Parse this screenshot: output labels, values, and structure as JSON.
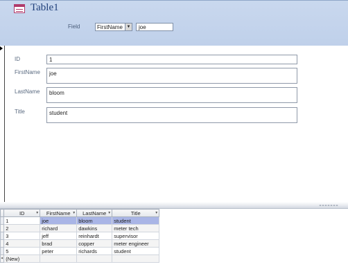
{
  "form": {
    "title": "Table1",
    "field_label": "Field",
    "field_select_value": "FirstName",
    "field_value": "joe"
  },
  "detail": {
    "fields": [
      {
        "label": "ID",
        "value": "1"
      },
      {
        "label": "FirstName",
        "value": "joe"
      },
      {
        "label": "LastName",
        "value": "bloom"
      },
      {
        "label": "Title",
        "value": "student"
      }
    ]
  },
  "datasheet": {
    "columns": [
      "ID",
      "FirstName",
      "LastName",
      "Title"
    ],
    "rows": [
      {
        "id": "1",
        "first": "joe",
        "last": "bloom",
        "title": "student"
      },
      {
        "id": "2",
        "first": "richard",
        "last": "dawkins",
        "title": "meter tech"
      },
      {
        "id": "3",
        "first": "jeff",
        "last": "reinhardt",
        "title": "supervisor"
      },
      {
        "id": "4",
        "first": "brad",
        "last": "copper",
        "title": "meter engineer"
      },
      {
        "id": "5",
        "first": "peter",
        "last": "richards",
        "title": "student"
      }
    ],
    "new_row_label": "(New)"
  },
  "icons": {
    "table": "table-icon",
    "dropdown": "chevron-down-icon",
    "record_pointer": "record-pointer-icon"
  },
  "colors": {
    "header_bg": "#c9d8ee",
    "title": "#1f3f7a",
    "selection": "#a9b5e6"
  }
}
